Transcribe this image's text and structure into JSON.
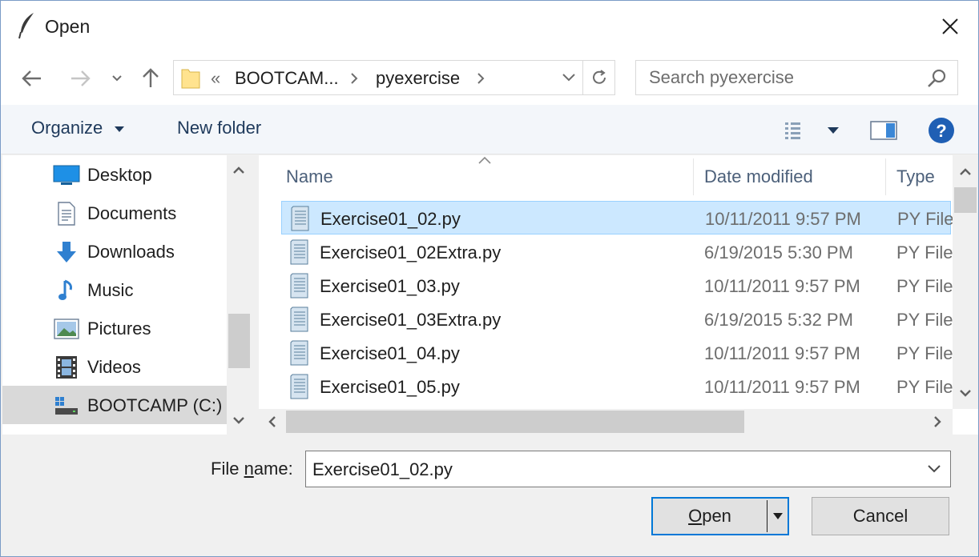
{
  "window": {
    "title": "Open",
    "close_icon": "close-icon",
    "app_icon": "feather-icon"
  },
  "navigation": {
    "back_icon": "arrow-left-icon",
    "forward_icon": "arrow-right-icon",
    "recent_icon": "chevron-down-icon",
    "up_icon": "arrow-up-icon"
  },
  "address": {
    "overflow": "«",
    "segments": [
      "BOOTCAM...",
      "pyexercise"
    ],
    "refresh_icon": "refresh-icon"
  },
  "search": {
    "placeholder": "Search pyexercise",
    "icon": "search-icon"
  },
  "toolbar": {
    "organize": "Organize",
    "new_folder": "New folder",
    "view_icon": "details-view-icon",
    "preview_icon": "preview-pane-icon",
    "help_icon": "help-icon"
  },
  "sidebar": {
    "items": [
      {
        "label": "Desktop",
        "icon": "desktop-icon"
      },
      {
        "label": "Documents",
        "icon": "documents-icon"
      },
      {
        "label": "Downloads",
        "icon": "downloads-icon"
      },
      {
        "label": "Music",
        "icon": "music-icon"
      },
      {
        "label": "Pictures",
        "icon": "pictures-icon"
      },
      {
        "label": "Videos",
        "icon": "videos-icon"
      },
      {
        "label": "BOOTCAMP (C:)",
        "icon": "drive-icon",
        "selected": true
      }
    ]
  },
  "files": {
    "columns": [
      "Name",
      "Date modified",
      "Type"
    ],
    "rows": [
      {
        "name": "Exercise01_02.py",
        "date": "10/11/2011 9:57 PM",
        "type": "PY File",
        "selected": true
      },
      {
        "name": "Exercise01_02Extra.py",
        "date": "6/19/2015 5:30 PM",
        "type": "PY File"
      },
      {
        "name": "Exercise01_03.py",
        "date": "10/11/2011 9:57 PM",
        "type": "PY File"
      },
      {
        "name": "Exercise01_03Extra.py",
        "date": "6/19/2015 5:32 PM",
        "type": "PY File"
      },
      {
        "name": "Exercise01_04.py",
        "date": "10/11/2011 9:57 PM",
        "type": "PY File"
      },
      {
        "name": "Exercise01_05.py",
        "date": "10/11/2011 9:57 PM",
        "type": "PY File"
      }
    ]
  },
  "footer": {
    "file_name_label_pre": "File ",
    "file_name_label_accel": "n",
    "file_name_label_post": "ame:",
    "file_name_value": "Exercise01_02.py",
    "open_accel": "O",
    "open_rest": "pen",
    "cancel": "Cancel"
  },
  "colors": {
    "selection": "#cce8ff",
    "accent": "#0078d7",
    "help": "#1f5fb4"
  }
}
